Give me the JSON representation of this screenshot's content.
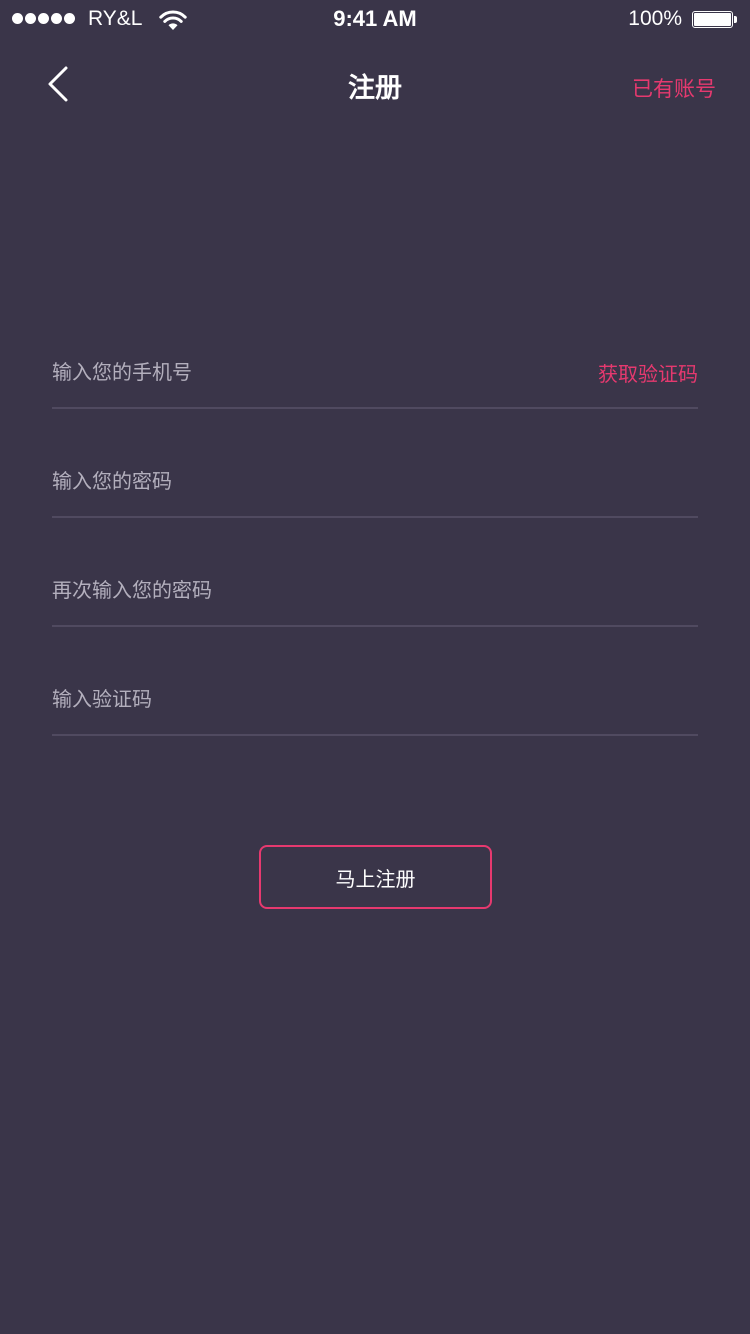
{
  "status_bar": {
    "carrier": "RY&L",
    "time": "9:41 AM",
    "battery": "100%",
    "battery_level": 1.0,
    "signal_bars": 5,
    "wifi_icon": "wifi-icon"
  },
  "nav": {
    "back_icon": "chevron-left-icon",
    "title": "注册",
    "right_link": "已有账号"
  },
  "form": {
    "phone_placeholder": "输入您的手机号",
    "get_code_label": "获取验证码",
    "password_placeholder": "输入您的密码",
    "confirm_password_placeholder": "再次输入您的密码",
    "code_placeholder": "输入验证码",
    "submit_label": "马上注册"
  },
  "colors": {
    "background": "#3a3549",
    "accent": "#e6396f",
    "divider": "#504a60",
    "placeholder": "#b3afbd"
  }
}
